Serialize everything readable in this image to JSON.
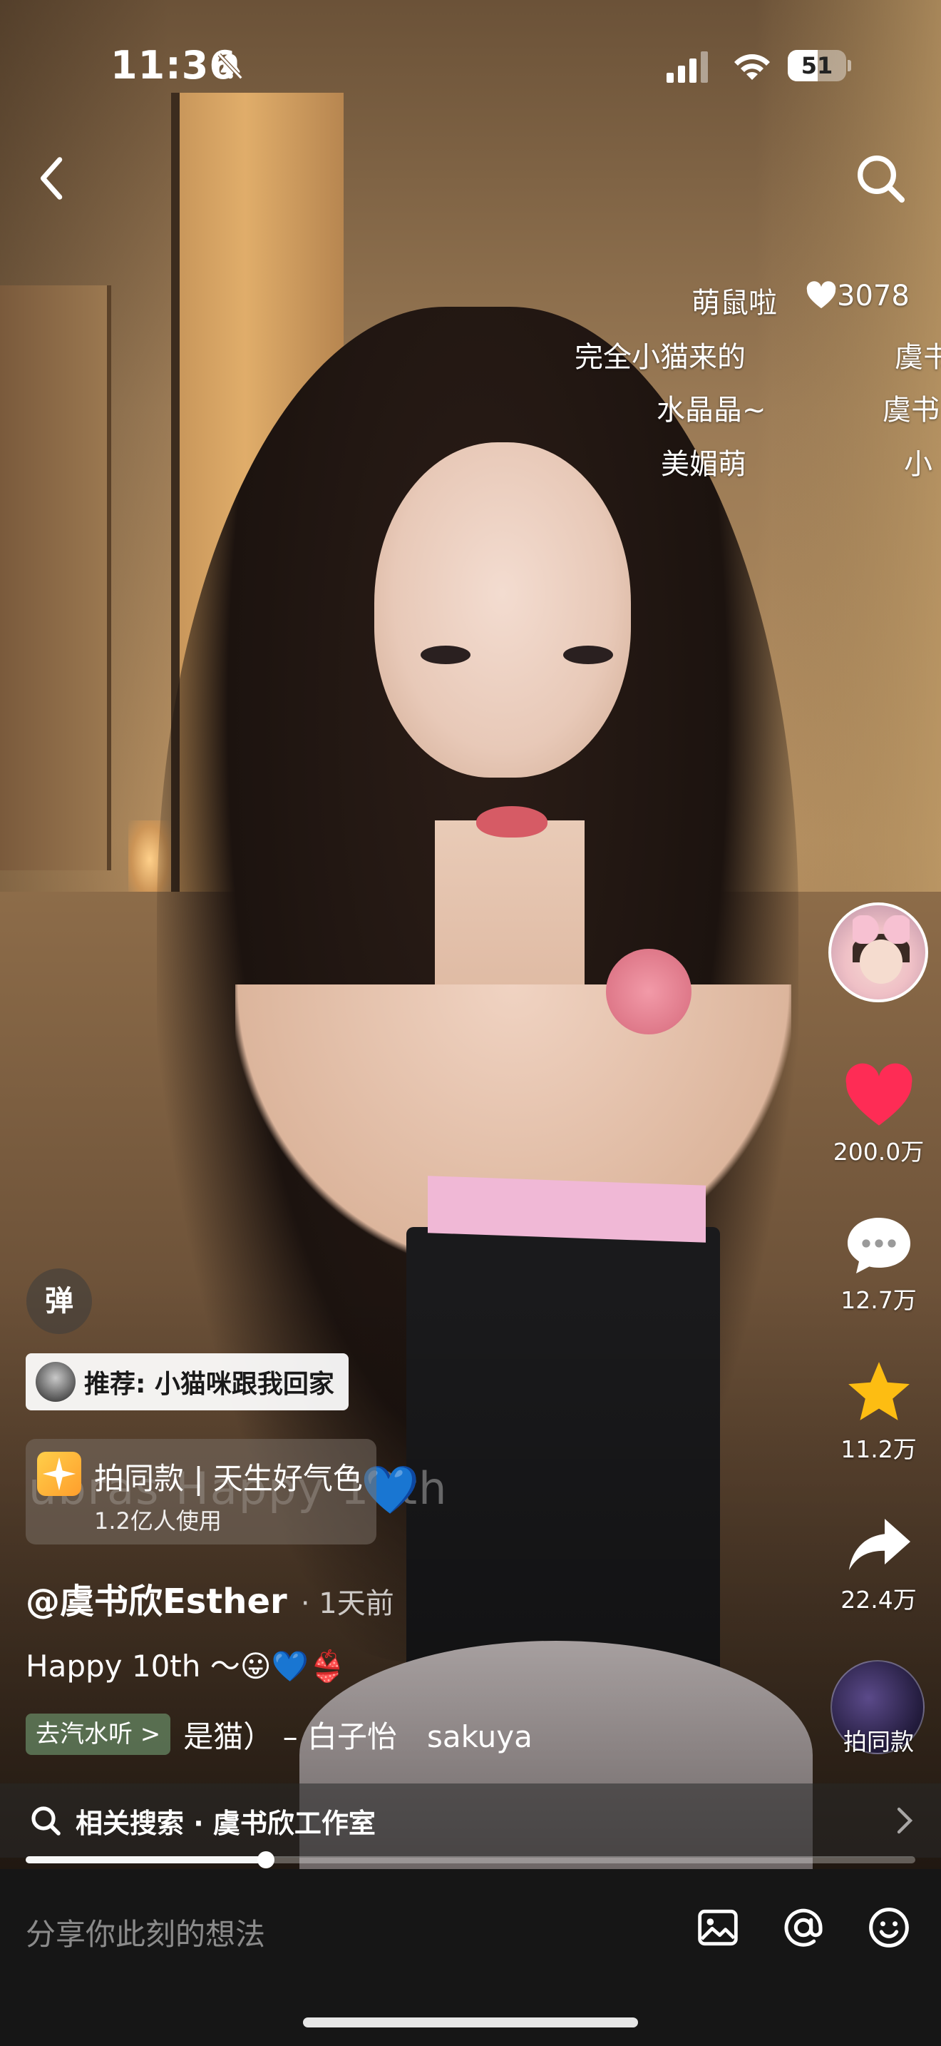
{
  "status_bar": {
    "time": "11:36",
    "battery_level": "51",
    "battery_fraction": 0.51,
    "icons": [
      "bell-slash-icon",
      "cellular-signal-icon",
      "wifi-icon",
      "battery-icon"
    ]
  },
  "nav": {
    "back_icon": "chevron-left-icon",
    "search_icon": "search-icon"
  },
  "danmaku": [
    {
      "text": "萌鼠啦"
    },
    {
      "text": "3078",
      "icon": "heart-icon"
    },
    {
      "text": "完全小猫来的"
    },
    {
      "text": "虞书"
    },
    {
      "text": "水晶晶~"
    },
    {
      "text": "虞书"
    },
    {
      "text": "美媚萌"
    },
    {
      "text": "小"
    }
  ],
  "actions": {
    "like_count": "200.0万",
    "comment_count": "12.7万",
    "favorite_count": "11.2万",
    "share_count": "22.4万",
    "music_label": "拍同款",
    "colors": {
      "like": "#fe2c55",
      "favorite": "#fdbd12"
    }
  },
  "overlay": {
    "danmu_toggle": "弹",
    "recommend": "推荐: 小猫咪跟我回家",
    "effect_title": "拍同款 | 天生好气色",
    "effect_sub": "1.2亿人使用",
    "ghost_text": "ubras Happy 10th",
    "ghost_emoji": "💙"
  },
  "post": {
    "author": "@虞书欣Esther",
    "time_ago": "· 1天前",
    "caption": "Happy 10th ～😛💙👙",
    "music_badge": "去汽水听 >",
    "music_title": "是猫） – 白子怡　sakuya"
  },
  "related": {
    "text": "相关搜索 · 虞书欣工作室"
  },
  "progress": {
    "fraction": 0.27
  },
  "comment_bar": {
    "placeholder": "分享你此刻的想法",
    "icons": [
      "image-icon",
      "at-icon",
      "emoji-icon"
    ]
  }
}
